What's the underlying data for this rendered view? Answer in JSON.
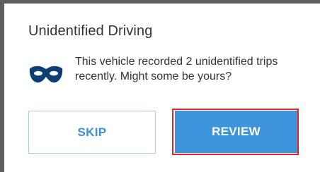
{
  "dialog": {
    "title": "Unidentified Driving",
    "message": "This vehicle recorded 2 unidentified trips recently. Might some be yours?",
    "icon": "mask-icon"
  },
  "buttons": {
    "skip_label": "SKIP",
    "review_label": "REVIEW"
  },
  "colors": {
    "accent": "#3d95dc",
    "icon": "#0d3f73",
    "highlight_border": "#d9262b"
  }
}
